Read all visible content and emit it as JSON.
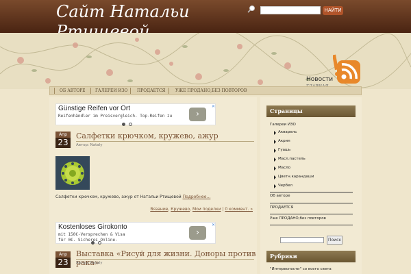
{
  "header": {
    "site_title": "Сайт Натальи Ртищевой",
    "search_button": "НАЙТИ",
    "search_value": ""
  },
  "rss": {
    "news": "Новости",
    "main": "ГЛАВНАЯ"
  },
  "nav": {
    "items": [
      "ОБ АВТОРЕ",
      "ГАЛЕРЕИ ИЗО",
      "ПРОДАЕТСЯ",
      "УЖЕ ПРОДАНО,БЕЗ ПОВТОРОВ"
    ]
  },
  "ads": [
    {
      "title": "Günstige Reifen vor Ort",
      "text": "Reifenhändler im Preisvergleich. Top-Reifen zu",
      "button": "›"
    },
    {
      "title": "Kostenloses Girokonto",
      "text": "mit 150€-Versprechen & Visa\nfür 0€. Sicheres Online-",
      "button": "›"
    }
  ],
  "posts": [
    {
      "month": "Апр",
      "day": "23",
      "title": "Салфетки крючком, кружево, ажур",
      "author": "Автор: Nataly",
      "excerpt": "Салфетки крючком, кружево, ажур от Натальи Ртищевой",
      "more": "Подробнее…",
      "tags": [
        "Вязание",
        "Кружево",
        "Мои поделки"
      ],
      "comments": "0 коммент. »"
    },
    {
      "month": "Апр",
      "day": "23",
      "title": "Выставка «Рисуй для жизни. Доноры против рака»",
      "author": "Автор: Nataly"
    }
  ],
  "sidebar": {
    "pages_title": "Страницы",
    "gallery": "Галереи ИЗО",
    "gallery_items": [
      "Акварель",
      "Акрил",
      "Гуашь",
      "Масл.пастель",
      "Масло",
      "Цветн.карандаши",
      "Чербел"
    ],
    "about": "Об авторе",
    "for_sale": "ПРОДАЕТСЯ",
    "sold": "Уже ПРОДАНО,без повторов",
    "search_button": "Поиск",
    "rubrics_title": "Рубрики",
    "rubric_first": "\"Интересности\" со всего света"
  },
  "colors": {
    "header": "#5a2e18",
    "accent": "#7a5336",
    "search_button": "#b0542a",
    "rss": "#e8882a"
  }
}
